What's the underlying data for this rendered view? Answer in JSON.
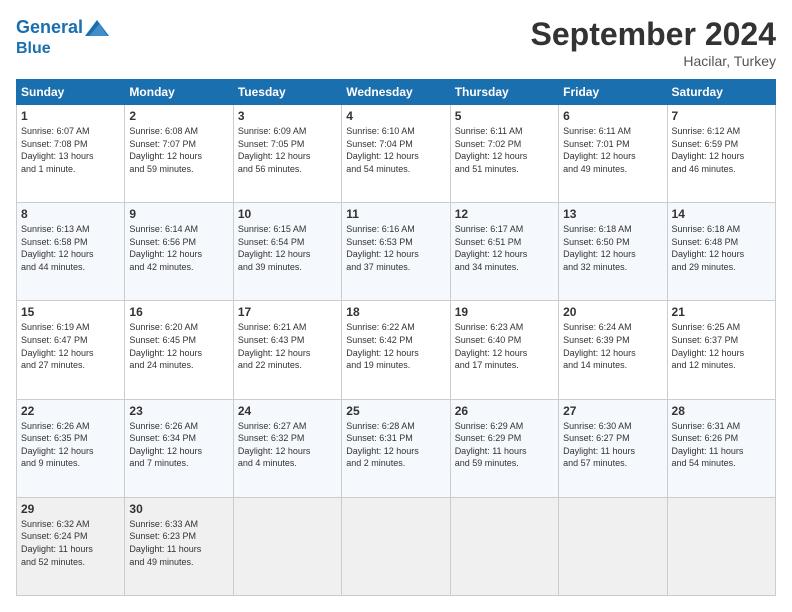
{
  "header": {
    "logo_line1": "General",
    "logo_line2": "Blue",
    "month": "September 2024",
    "location": "Hacilar, Turkey"
  },
  "weekdays": [
    "Sunday",
    "Monday",
    "Tuesday",
    "Wednesday",
    "Thursday",
    "Friday",
    "Saturday"
  ],
  "weeks": [
    [
      {
        "day": "1",
        "lines": [
          "Sunrise: 6:07 AM",
          "Sunset: 7:08 PM",
          "Daylight: 13 hours",
          "and 1 minute."
        ]
      },
      {
        "day": "2",
        "lines": [
          "Sunrise: 6:08 AM",
          "Sunset: 7:07 PM",
          "Daylight: 12 hours",
          "and 59 minutes."
        ]
      },
      {
        "day": "3",
        "lines": [
          "Sunrise: 6:09 AM",
          "Sunset: 7:05 PM",
          "Daylight: 12 hours",
          "and 56 minutes."
        ]
      },
      {
        "day": "4",
        "lines": [
          "Sunrise: 6:10 AM",
          "Sunset: 7:04 PM",
          "Daylight: 12 hours",
          "and 54 minutes."
        ]
      },
      {
        "day": "5",
        "lines": [
          "Sunrise: 6:11 AM",
          "Sunset: 7:02 PM",
          "Daylight: 12 hours",
          "and 51 minutes."
        ]
      },
      {
        "day": "6",
        "lines": [
          "Sunrise: 6:11 AM",
          "Sunset: 7:01 PM",
          "Daylight: 12 hours",
          "and 49 minutes."
        ]
      },
      {
        "day": "7",
        "lines": [
          "Sunrise: 6:12 AM",
          "Sunset: 6:59 PM",
          "Daylight: 12 hours",
          "and 46 minutes."
        ]
      }
    ],
    [
      {
        "day": "8",
        "lines": [
          "Sunrise: 6:13 AM",
          "Sunset: 6:58 PM",
          "Daylight: 12 hours",
          "and 44 minutes."
        ]
      },
      {
        "day": "9",
        "lines": [
          "Sunrise: 6:14 AM",
          "Sunset: 6:56 PM",
          "Daylight: 12 hours",
          "and 42 minutes."
        ]
      },
      {
        "day": "10",
        "lines": [
          "Sunrise: 6:15 AM",
          "Sunset: 6:54 PM",
          "Daylight: 12 hours",
          "and 39 minutes."
        ]
      },
      {
        "day": "11",
        "lines": [
          "Sunrise: 6:16 AM",
          "Sunset: 6:53 PM",
          "Daylight: 12 hours",
          "and 37 minutes."
        ]
      },
      {
        "day": "12",
        "lines": [
          "Sunrise: 6:17 AM",
          "Sunset: 6:51 PM",
          "Daylight: 12 hours",
          "and 34 minutes."
        ]
      },
      {
        "day": "13",
        "lines": [
          "Sunrise: 6:18 AM",
          "Sunset: 6:50 PM",
          "Daylight: 12 hours",
          "and 32 minutes."
        ]
      },
      {
        "day": "14",
        "lines": [
          "Sunrise: 6:18 AM",
          "Sunset: 6:48 PM",
          "Daylight: 12 hours",
          "and 29 minutes."
        ]
      }
    ],
    [
      {
        "day": "15",
        "lines": [
          "Sunrise: 6:19 AM",
          "Sunset: 6:47 PM",
          "Daylight: 12 hours",
          "and 27 minutes."
        ]
      },
      {
        "day": "16",
        "lines": [
          "Sunrise: 6:20 AM",
          "Sunset: 6:45 PM",
          "Daylight: 12 hours",
          "and 24 minutes."
        ]
      },
      {
        "day": "17",
        "lines": [
          "Sunrise: 6:21 AM",
          "Sunset: 6:43 PM",
          "Daylight: 12 hours",
          "and 22 minutes."
        ]
      },
      {
        "day": "18",
        "lines": [
          "Sunrise: 6:22 AM",
          "Sunset: 6:42 PM",
          "Daylight: 12 hours",
          "and 19 minutes."
        ]
      },
      {
        "day": "19",
        "lines": [
          "Sunrise: 6:23 AM",
          "Sunset: 6:40 PM",
          "Daylight: 12 hours",
          "and 17 minutes."
        ]
      },
      {
        "day": "20",
        "lines": [
          "Sunrise: 6:24 AM",
          "Sunset: 6:39 PM",
          "Daylight: 12 hours",
          "and 14 minutes."
        ]
      },
      {
        "day": "21",
        "lines": [
          "Sunrise: 6:25 AM",
          "Sunset: 6:37 PM",
          "Daylight: 12 hours",
          "and 12 minutes."
        ]
      }
    ],
    [
      {
        "day": "22",
        "lines": [
          "Sunrise: 6:26 AM",
          "Sunset: 6:35 PM",
          "Daylight: 12 hours",
          "and 9 minutes."
        ]
      },
      {
        "day": "23",
        "lines": [
          "Sunrise: 6:26 AM",
          "Sunset: 6:34 PM",
          "Daylight: 12 hours",
          "and 7 minutes."
        ]
      },
      {
        "day": "24",
        "lines": [
          "Sunrise: 6:27 AM",
          "Sunset: 6:32 PM",
          "Daylight: 12 hours",
          "and 4 minutes."
        ]
      },
      {
        "day": "25",
        "lines": [
          "Sunrise: 6:28 AM",
          "Sunset: 6:31 PM",
          "Daylight: 12 hours",
          "and 2 minutes."
        ]
      },
      {
        "day": "26",
        "lines": [
          "Sunrise: 6:29 AM",
          "Sunset: 6:29 PM",
          "Daylight: 11 hours",
          "and 59 minutes."
        ]
      },
      {
        "day": "27",
        "lines": [
          "Sunrise: 6:30 AM",
          "Sunset: 6:27 PM",
          "Daylight: 11 hours",
          "and 57 minutes."
        ]
      },
      {
        "day": "28",
        "lines": [
          "Sunrise: 6:31 AM",
          "Sunset: 6:26 PM",
          "Daylight: 11 hours",
          "and 54 minutes."
        ]
      }
    ],
    [
      {
        "day": "29",
        "lines": [
          "Sunrise: 6:32 AM",
          "Sunset: 6:24 PM",
          "Daylight: 11 hours",
          "and 52 minutes."
        ]
      },
      {
        "day": "30",
        "lines": [
          "Sunrise: 6:33 AM",
          "Sunset: 6:23 PM",
          "Daylight: 11 hours",
          "and 49 minutes."
        ]
      },
      {
        "day": "",
        "lines": []
      },
      {
        "day": "",
        "lines": []
      },
      {
        "day": "",
        "lines": []
      },
      {
        "day": "",
        "lines": []
      },
      {
        "day": "",
        "lines": []
      }
    ]
  ]
}
